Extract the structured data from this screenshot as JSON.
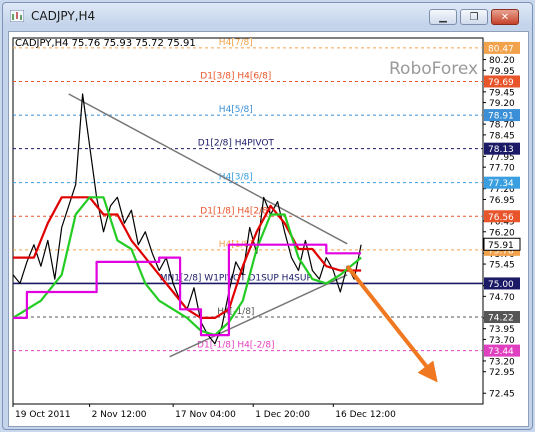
{
  "window": {
    "title": "CADJPY,H4",
    "buttons": [
      {
        "name": "minimize",
        "glyph": "▁"
      },
      {
        "name": "restore",
        "glyph": "❐"
      },
      {
        "name": "close",
        "glyph": "✕"
      }
    ]
  },
  "chart_data": {
    "type": "line",
    "symbol_info": "CADJPY,H4  75.76 75.93 75.72 75.91",
    "watermark": "RoboForex",
    "ylim": [
      72.2,
      80.7
    ],
    "y_ticks": [
      "80.20",
      "79.95",
      "79.45",
      "79.20",
      "78.70",
      "78.45",
      "77.95",
      "77.70",
      "77.20",
      "76.95",
      "76.45",
      "76.20",
      "75.70",
      "75.45",
      "74.95",
      "74.70",
      "74.20",
      "73.95",
      "73.70",
      "73.20",
      "72.95",
      "72.45"
    ],
    "x_labels": [
      "19 Oct 2011",
      "2 Nov 12:00",
      "17 Nov 04:00",
      "1 Dec 20:00",
      "16 Dec 12:00"
    ],
    "levels": [
      {
        "price": 80.47,
        "label": "H4[7/8]",
        "color": "#f2a24a",
        "dash": true
      },
      {
        "price": 79.69,
        "label": "D1[3/8] H4[6/8]",
        "color": "#e8552b",
        "dash": true
      },
      {
        "price": 78.91,
        "label": "H4[5/8]",
        "color": "#3a8fd6",
        "dash": true
      },
      {
        "price": 78.13,
        "label": "D1[2/8] H4PIVOT",
        "color": "#1a1a66",
        "dash": true
      },
      {
        "price": 77.34,
        "label": "H4[3/8]",
        "color": "#3a9fe0",
        "dash": true
      },
      {
        "price": 76.56,
        "label": "D1[1/8] H4[2/8]",
        "color": "#e8552b",
        "dash": true
      },
      {
        "price": 75.78,
        "label": "H4[1/8]",
        "color": "#f2a24a",
        "dash": true
      },
      {
        "price": 75.0,
        "label": "MN1[2/8] W1PIVOT D1SUP H4SUP",
        "color": "#1a1a66",
        "dash": false
      },
      {
        "price": 74.22,
        "label": "H4[-1/8]",
        "color": "#555555",
        "dash": true
      },
      {
        "price": 73.44,
        "label": "D1[-1/8] H4[-2/8]",
        "color": "#e040c0",
        "dash": true
      }
    ],
    "current_price": {
      "value": 75.91,
      "label": "75.91"
    },
    "series": [
      {
        "kind": "price",
        "color": "#000000",
        "x": [
          0,
          2,
          4,
          6,
          8,
          10,
          12,
          14,
          16,
          18,
          20,
          22,
          24,
          26,
          28,
          30,
          32,
          34,
          36,
          38,
          40,
          42,
          44,
          46,
          48,
          50,
          52,
          54,
          56,
          58,
          60,
          62,
          64,
          66,
          68,
          70,
          72,
          74,
          76,
          78,
          80,
          82,
          84,
          86,
          88,
          90,
          92,
          94,
          96,
          98,
          100
        ],
        "values": [
          75.2,
          75.0,
          75.5,
          75.9,
          75.4,
          76.0,
          75.1,
          76.3,
          76.8,
          77.3,
          79.4,
          78.2,
          77.0,
          76.2,
          76.8,
          77.0,
          76.4,
          76.7,
          75.9,
          76.2,
          75.7,
          75.3,
          75.6,
          75.0,
          74.6,
          74.4,
          74.9,
          74.1,
          73.8,
          73.6,
          74.0,
          74.8,
          75.5,
          75.2,
          76.3,
          75.7,
          77.0,
          76.6,
          76.9,
          76.2,
          75.6,
          75.3,
          76.0,
          75.3,
          75.1,
          75.6,
          75.3,
          74.8,
          75.4,
          75.1,
          75.9
        ]
      },
      {
        "kind": "red_line",
        "color": "#e00000",
        "x": [
          0,
          6,
          10,
          14,
          18,
          22,
          26,
          30,
          34,
          38,
          42,
          46,
          50,
          54,
          58,
          62,
          66,
          70,
          74,
          78,
          82,
          86,
          90,
          94,
          100
        ],
        "values": [
          75.6,
          75.6,
          76.4,
          77.0,
          77.0,
          77.0,
          76.6,
          76.6,
          76.0,
          75.6,
          75.2,
          74.8,
          74.4,
          74.2,
          74.2,
          74.4,
          75.4,
          76.2,
          76.8,
          76.4,
          75.8,
          75.8,
          75.4,
          75.3,
          75.3
        ]
      },
      {
        "kind": "green_line",
        "color": "#22cc22",
        "x": [
          0,
          8,
          14,
          18,
          22,
          26,
          30,
          34,
          38,
          42,
          46,
          50,
          54,
          58,
          62,
          66,
          70,
          74,
          78,
          82,
          86,
          90,
          94,
          100
        ],
        "values": [
          74.2,
          74.6,
          75.2,
          76.6,
          77.0,
          77.0,
          76.0,
          75.8,
          75.0,
          74.6,
          74.4,
          74.2,
          73.9,
          73.8,
          74.1,
          74.6,
          75.8,
          76.6,
          76.6,
          75.6,
          75.1,
          75.0,
          75.2,
          75.6
        ]
      },
      {
        "kind": "magenta_line",
        "color": "#e000e0",
        "x": [
          0,
          4,
          4,
          24,
          24,
          42,
          42,
          48,
          48,
          54,
          54,
          62,
          62,
          80,
          80,
          90,
          90,
          100
        ],
        "values": [
          74.2,
          74.2,
          74.8,
          74.8,
          75.5,
          75.5,
          75.6,
          75.6,
          74.4,
          74.4,
          73.8,
          73.8,
          75.9,
          75.9,
          75.9,
          75.9,
          75.7,
          75.7
        ]
      }
    ],
    "triangle": [
      {
        "from": [
          16,
          79.4
        ],
        "to": [
          96,
          75.92
        ]
      },
      {
        "from": [
          45,
          73.3
        ],
        "to": [
          96,
          75.2
        ]
      }
    ],
    "forecast_arrow": {
      "from": [
        96,
        75.4
      ],
      "to": [
        122,
        72.7
      ],
      "color": "#f07820"
    }
  }
}
